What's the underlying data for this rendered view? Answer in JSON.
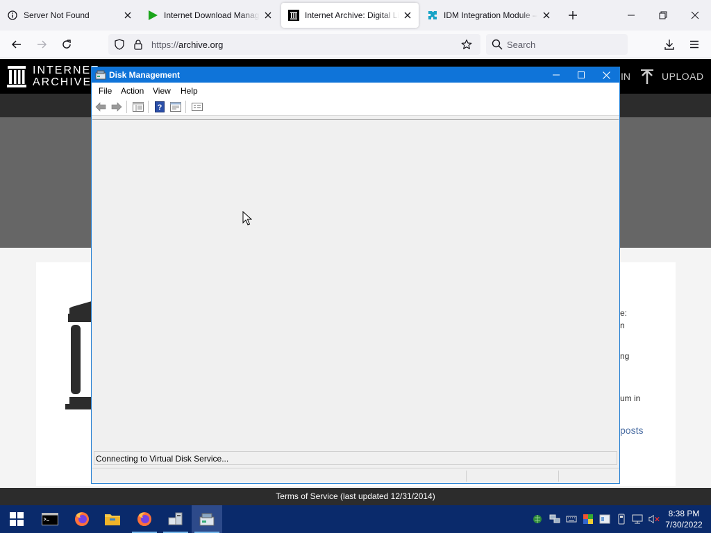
{
  "browser": {
    "tabs": [
      {
        "title": "Server Not Found",
        "icon": "info-icon",
        "active": false
      },
      {
        "title": "Internet Download Manager: T",
        "icon": "idm-play-icon",
        "active": false
      },
      {
        "title": "Internet Archive: Digital Librar",
        "icon": "archive-icon",
        "active": true
      },
      {
        "title": "IDM Integration Module – Get",
        "icon": "puzzle-icon",
        "active": false
      }
    ],
    "url_scheme": "https://",
    "url_host": "archive.org",
    "search_placeholder": "Search"
  },
  "page": {
    "logo_line1": "INTERNET",
    "logo_line2": "ARCHIVE",
    "login_fragment": "IN",
    "upload": "UPLOAD",
    "side_text": [
      {
        "text": "e:"
      },
      {
        "text": "n"
      },
      {
        "text": "ng"
      },
      {
        "text": "um in"
      }
    ],
    "link_fragment": "posts",
    "footer": "Terms of Service (last updated 12/31/2014)"
  },
  "disk_management": {
    "title": "Disk Management",
    "menu": [
      "File",
      "Action",
      "View",
      "Help"
    ],
    "status": "Connecting to Virtual Disk Service..."
  },
  "taskbar": {
    "time": "8:38 PM",
    "date": "7/30/2022",
    "colors": {
      "taskbar_bg": "#0a2a6b",
      "title_blue": "#0f74d9"
    }
  }
}
